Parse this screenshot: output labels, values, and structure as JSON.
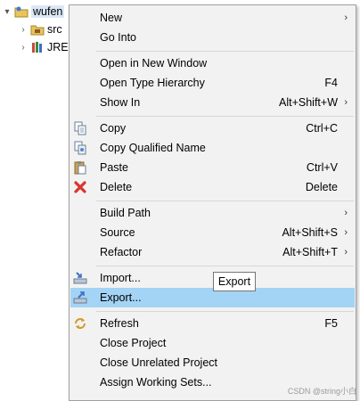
{
  "tree": {
    "project_label": "wufen",
    "src_label": "src",
    "jre_label": "JRE"
  },
  "menu": {
    "items": [
      {
        "label": "New",
        "shortcut": "",
        "submenu": true
      },
      {
        "label": "Go Into",
        "shortcut": ""
      },
      {
        "label": "Open in New Window",
        "shortcut": ""
      },
      {
        "label": "Open Type Hierarchy",
        "shortcut": "F4"
      },
      {
        "label": "Show In",
        "shortcut": "Alt+Shift+W",
        "submenu": true
      },
      {
        "label": "Copy",
        "shortcut": "Ctrl+C"
      },
      {
        "label": "Copy Qualified Name",
        "shortcut": ""
      },
      {
        "label": "Paste",
        "shortcut": "Ctrl+V"
      },
      {
        "label": "Delete",
        "shortcut": "Delete"
      },
      {
        "label": "Build Path",
        "shortcut": "",
        "submenu": true
      },
      {
        "label": "Source",
        "shortcut": "Alt+Shift+S",
        "submenu": true
      },
      {
        "label": "Refactor",
        "shortcut": "Alt+Shift+T",
        "submenu": true
      },
      {
        "label": "Import...",
        "shortcut": ""
      },
      {
        "label": "Export...",
        "shortcut": "",
        "highlighted": true
      },
      {
        "label": "Refresh",
        "shortcut": "F5"
      },
      {
        "label": "Close Project",
        "shortcut": ""
      },
      {
        "label": "Close Unrelated Project",
        "shortcut": ""
      },
      {
        "label": "Assign Working Sets...",
        "shortcut": ""
      }
    ],
    "submenu_glyph": "›"
  },
  "tooltip": {
    "text": "Export"
  },
  "watermark": {
    "text": "CSDN @string小白"
  },
  "colors": {
    "highlight": "#a3d3f5",
    "menu_bg": "#f2f2f2",
    "delete_red": "#d9342b"
  }
}
